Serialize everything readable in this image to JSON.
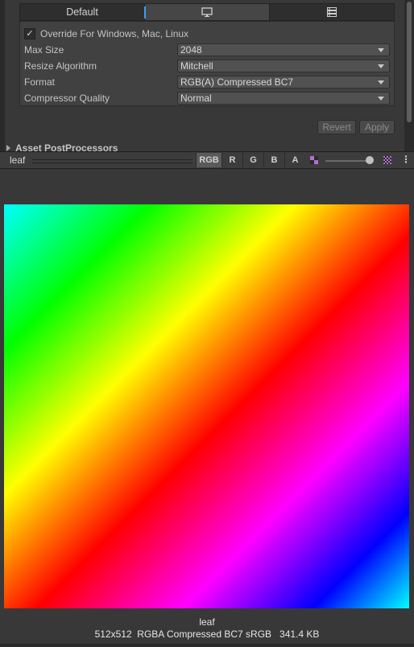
{
  "platform_tabs": [
    {
      "label": "Default",
      "icon": "",
      "active": false
    },
    {
      "label": "",
      "icon": "monitor-icon",
      "active": true
    },
    {
      "label": "",
      "icon": "server-icon",
      "active": false
    }
  ],
  "override": {
    "label": "Override For Windows, Mac, Linux",
    "checked": true
  },
  "fields": [
    {
      "label": "Max Size",
      "value": "2048"
    },
    {
      "label": "Resize Algorithm",
      "value": "Mitchell"
    },
    {
      "label": "Format",
      "value": "RGB(A) Compressed BC7"
    },
    {
      "label": "Compressor Quality",
      "value": "Normal"
    }
  ],
  "buttons": {
    "revert": "Revert",
    "apply": "Apply"
  },
  "section": {
    "label": "Asset PostProcessors"
  },
  "toolbar": {
    "title": "leaf",
    "channels": [
      "RGB",
      "R",
      "G",
      "B",
      "A"
    ],
    "active_channel": "RGB",
    "mip_level": 0.95
  },
  "preview": {
    "name": "leaf",
    "info": "512x512  RGBA Compressed BC7 sRGB   341.4 KB"
  }
}
